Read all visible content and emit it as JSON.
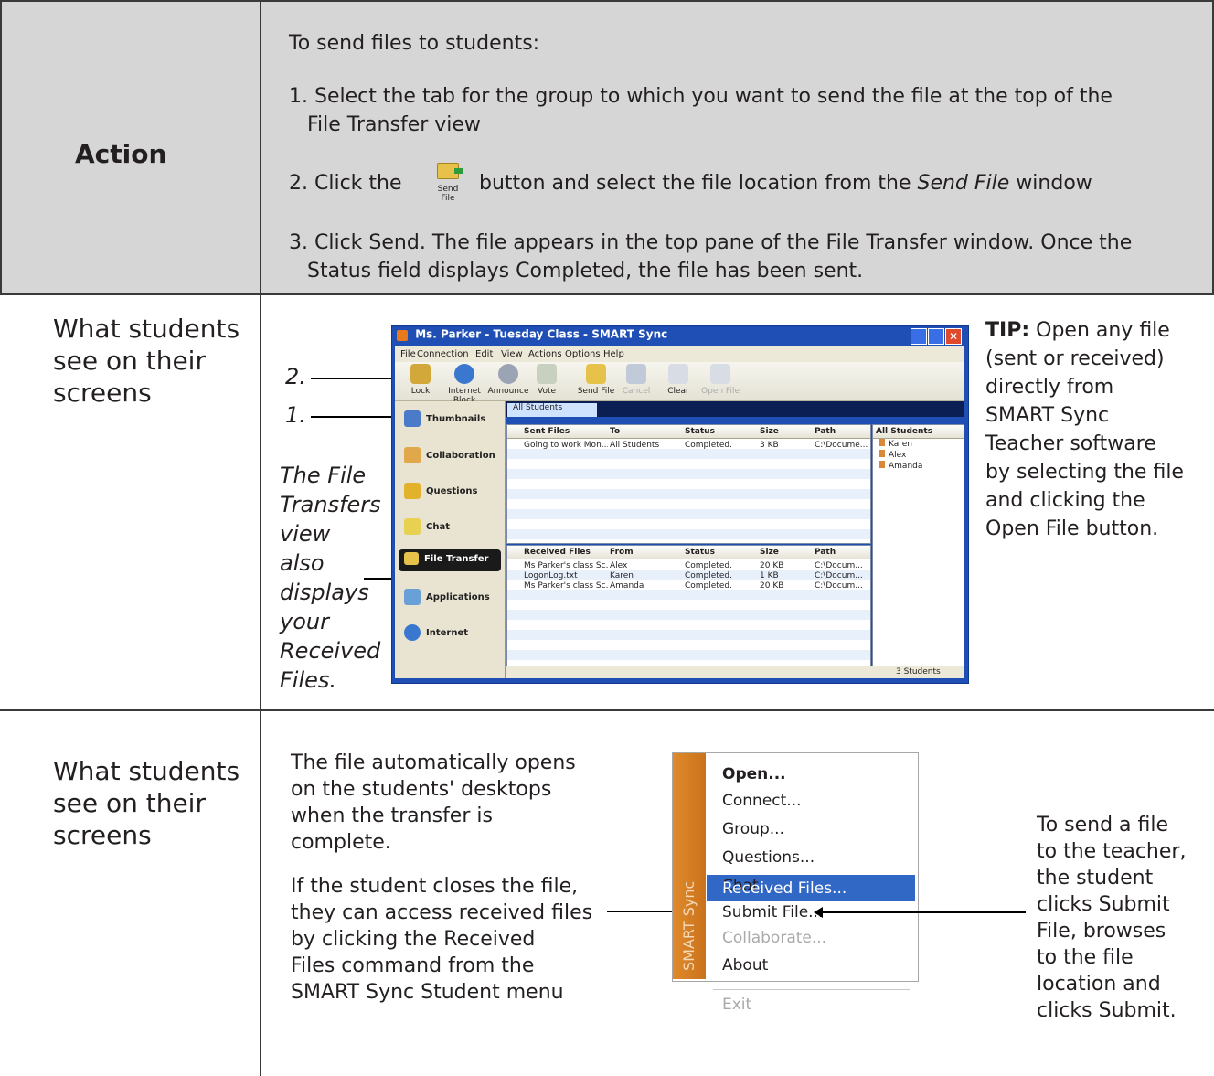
{
  "action_row": {
    "label": "Action",
    "heading": "To send files to students:",
    "step1": "1. Select the tab for the group to which you want to send the file at the top of the",
    "step1b": "File Transfer view",
    "step2a": "2. Click the",
    "step2_icon_label": "Send File",
    "step2b": "button and select the file location from the",
    "step2_italic": "Send File",
    "step2c": "window",
    "step3a": "3. Click",
    "step3_bold": "Send",
    "step3b": ". The file appears in the top pane of the File Transfer window. Once the",
    "step3c": "Status field displays",
    "step3_bold2": "Completed",
    "step3d": ", the file has been sent."
  },
  "row2": {
    "label_lines": [
      "What students",
      "see on their",
      "screens"
    ],
    "annot_2": "2.",
    "annot_1": "1.",
    "italic_note_lines": [
      "The File",
      "Transfers",
      "view",
      "also",
      "displays",
      "your",
      "Received",
      "Files."
    ],
    "tip_bold": "TIP:",
    "tip_lines": [
      "Open any file",
      "(sent or received)",
      "directly from",
      "SMART Sync",
      "Teacher software",
      "by selecting the file",
      "and clicking the"
    ],
    "tip_last_bold": "Open File",
    "tip_last": " button."
  },
  "window": {
    "title": "Ms.  Parker - Tuesday Class - SMART Sync",
    "menus": [
      "File",
      "Connection",
      "Edit",
      "View",
      "Actions",
      "Options",
      "Help"
    ],
    "toolbar": [
      "Lock",
      "Internet Block",
      "Announce",
      "Vote",
      "Send File",
      "Cancel",
      "Clear",
      "Open File"
    ],
    "sidebar": [
      "Thumbnails",
      "Collaboration",
      "Questions",
      "Chat",
      "File Transfer",
      "Applications",
      "Internet"
    ],
    "tab": "All Students",
    "sent_headers": [
      "Sent Files",
      "To",
      "Status",
      "Size",
      "Path"
    ],
    "sent_rows": [
      [
        "Going to work Mon...",
        "All Students",
        "Completed.",
        "3 KB",
        "C:\\Docume..."
      ]
    ],
    "recv_headers": [
      "Received Files",
      "From",
      "Status",
      "Size",
      "Path"
    ],
    "recv_rows": [
      [
        "Ms Parker's class Sc...",
        "Alex",
        "Completed.",
        "20 KB",
        "C:\\Docum..."
      ],
      [
        "LogonLog.txt",
        "Karen",
        "Completed.",
        "1 KB",
        "C:\\Docum..."
      ],
      [
        "Ms Parker's class Sc...",
        "Amanda",
        "Completed.",
        "20 KB",
        "C:\\Docum..."
      ]
    ],
    "students_header": "All Students",
    "students": [
      "Karen",
      "Alex",
      "Amanda"
    ],
    "status_count": "3 Students"
  },
  "row3": {
    "label_lines": [
      "What students",
      "see on their",
      "screens"
    ],
    "para1_lines": [
      "The file automatically opens",
      "on the students' desktops",
      "when the transfer is",
      "complete."
    ],
    "para2_lines": [
      "If the student closes the file,",
      "they can access received files",
      "by clicking the"
    ],
    "para2_bold1": "Received",
    "para2_bold2": "Files",
    "para2_tail": " command from the",
    "para2_last": "SMART Sync Student menu",
    "menu_items": [
      "Open...",
      "Connect...",
      "Group...",
      "Questions...",
      "Chat...",
      "Submit File...",
      "Received Files...",
      "Collaborate...",
      "About",
      "Exit"
    ],
    "menu_strip": "SMART Sync",
    "right_lines": [
      "To send a file",
      "to the teacher,",
      "the student",
      "clicks"
    ],
    "right_bold1": "Submit",
    "right_bold2": "File",
    "right_after": ", browses",
    "right_lines2": [
      "to the file",
      "location and",
      "clicks"
    ],
    "right_bold3": "Submit",
    "right_end": "."
  }
}
